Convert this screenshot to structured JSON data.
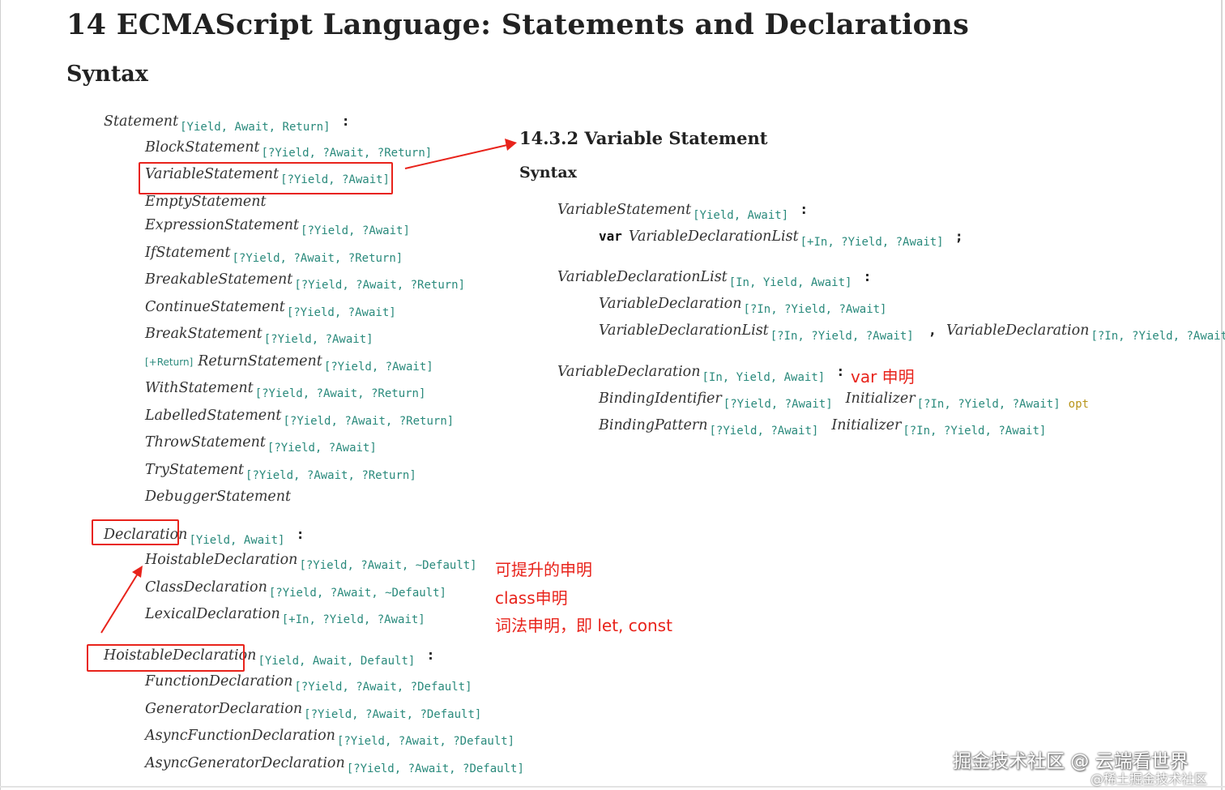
{
  "doc": {
    "heading": "14  ECMAScript Language: Statements and Declarations",
    "syntax_label": "Syntax"
  },
  "statement": {
    "head": {
      "name": "Statement",
      "params": "[Yield, Await, Return]",
      "colon": ":"
    },
    "alts": [
      {
        "name": "BlockStatement",
        "params": "[?Yield, ?Await, ?Return]"
      },
      {
        "name": "VariableStatement",
        "params": "[?Yield, ?Await]"
      },
      {
        "name": "EmptyStatement",
        "params": ""
      },
      {
        "name": "ExpressionStatement",
        "params": "[?Yield, ?Await]"
      },
      {
        "name": "IfStatement",
        "params": "[?Yield, ?Await, ?Return]"
      },
      {
        "name": "BreakableStatement",
        "params": "[?Yield, ?Await, ?Return]"
      },
      {
        "name": "ContinueStatement",
        "params": "[?Yield, ?Await]"
      },
      {
        "name": "BreakStatement",
        "params": "[?Yield, ?Await]"
      },
      {
        "name": "ReturnStatement",
        "params": "[?Yield, ?Await]",
        "prefix": "[+Return]"
      },
      {
        "name": "WithStatement",
        "params": "[?Yield, ?Await, ?Return]"
      },
      {
        "name": "LabelledStatement",
        "params": "[?Yield, ?Await, ?Return]"
      },
      {
        "name": "ThrowStatement",
        "params": "[?Yield, ?Await]"
      },
      {
        "name": "TryStatement",
        "params": "[?Yield, ?Await, ?Return]"
      },
      {
        "name": "DebuggerStatement",
        "params": ""
      }
    ]
  },
  "declaration": {
    "head": {
      "name": "Declaration",
      "params": "[Yield, Await]",
      "colon": ":"
    },
    "alts": [
      {
        "name": "HoistableDeclaration",
        "params": "[?Yield, ?Await, ~Default]"
      },
      {
        "name": "ClassDeclaration",
        "params": "[?Yield, ?Await, ~Default]"
      },
      {
        "name": "LexicalDeclaration",
        "params": "[+In, ?Yield, ?Await]"
      }
    ]
  },
  "hoistable": {
    "head": {
      "name": "HoistableDeclaration",
      "params": "[Yield, Await, Default]",
      "colon": ":"
    },
    "alts": [
      {
        "name": "FunctionDeclaration",
        "params": "[?Yield, ?Await, ?Default]"
      },
      {
        "name": "GeneratorDeclaration",
        "params": "[?Yield, ?Await, ?Default]"
      },
      {
        "name": "AsyncFunctionDeclaration",
        "params": "[?Yield, ?Await, ?Default]"
      },
      {
        "name": "AsyncGeneratorDeclaration",
        "params": "[?Yield, ?Await, ?Default]"
      }
    ]
  },
  "section": {
    "title": "14.3.2  Variable Statement",
    "syntax_label": "Syntax",
    "var_stmt": {
      "head": {
        "name": "VariableStatement",
        "params": "[Yield, Await]",
        "colon": ":"
      },
      "rhs": {
        "keyword": "var",
        "name": "VariableDeclarationList",
        "params": "[+In, ?Yield, ?Await]",
        "terminator": ";"
      }
    },
    "var_decl_list": {
      "head": {
        "name": "VariableDeclarationList",
        "params": "[In, Yield, Await]",
        "colon": ":"
      },
      "alt1": {
        "name": "VariableDeclaration",
        "params": "[?In, ?Yield, ?Await]"
      },
      "alt2": {
        "name": "VariableDeclarationList",
        "params": "[?In, ?Yield, ?Await]",
        "sep": ",",
        "name2": "VariableDeclaration",
        "params2": "[?In, ?Yield, ?Await]"
      }
    },
    "var_decl": {
      "head": {
        "name": "VariableDeclaration",
        "params": "[In, Yield, Await]",
        "colon": ":"
      },
      "alt1": {
        "name": "BindingIdentifier",
        "params": "[?Yield, ?Await]",
        "name2": "Initializer",
        "params2": "[?In, ?Yield, ?Await]",
        "opt": "opt"
      },
      "alt2": {
        "name": "BindingPattern",
        "params": "[?Yield, ?Await]",
        "name2": "Initializer",
        "params2": "[?In, ?Yield, ?Await]"
      }
    }
  },
  "annotations": {
    "var_decl": "var 申明",
    "hoistable": "可提升的申明",
    "class_decl": "class申明",
    "lexical": "词法申明，即 let, const"
  },
  "watermark": {
    "main": "掘金技术社区 @ 云端看世界",
    "sub": "@稀土掘金技术社区"
  },
  "colors": {
    "annotation": "#e8231b",
    "params": "#2a8a7c",
    "opt": "#b8941a"
  }
}
